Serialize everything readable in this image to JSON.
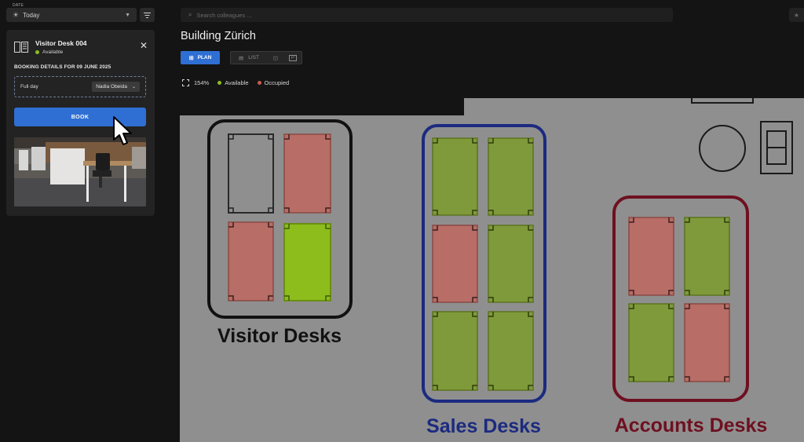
{
  "topbar": {
    "date_label": "DATE",
    "date_value": "Today",
    "search_placeholder": "Search colleagues ..."
  },
  "panel": {
    "desk_name": "Visitor Desk 004",
    "status": "Available",
    "booking_heading": "BOOKING DETAILS FOR 09 JUNE 2025",
    "duration": "Full day",
    "person": "Nadia Obeida",
    "book_label": "BOOK"
  },
  "main": {
    "title": "Building Zürich",
    "view_tabs": {
      "plan": "PLAN",
      "list": "LIST",
      "parking": "P"
    },
    "zoom": "154%",
    "legend": {
      "available": "Available",
      "occupied": "Occupied"
    }
  },
  "floorplan": {
    "zones": [
      {
        "label": "Visitor Desks",
        "color": "#111111",
        "desks": [
          "empty",
          "occupied",
          "occupied",
          "available-selected"
        ]
      },
      {
        "label": "Sales Desks",
        "color": "#1c2a80",
        "desks": [
          "available",
          "available",
          "occupied",
          "available",
          "available",
          "available"
        ]
      },
      {
        "label": "Accounts Desks",
        "color": "#6e1020",
        "desks": [
          "occupied",
          "available",
          "available",
          "occupied"
        ]
      }
    ]
  },
  "colors": {
    "accent": "#2f6fd3",
    "available": "#8cbd1c",
    "occupied": "#c85a50",
    "floor_bg": "#8f8f8f"
  }
}
